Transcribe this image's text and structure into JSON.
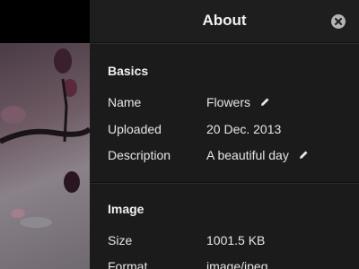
{
  "about_panel": {
    "title": "About",
    "close_icon": "close-circle-icon",
    "basics": {
      "heading": "Basics",
      "rows": [
        {
          "label": "Name",
          "value": "Flowers",
          "editable": true
        },
        {
          "label": "Uploaded",
          "value": "20 Dec. 2013",
          "editable": false
        },
        {
          "label": "Description",
          "value": "A beautiful day",
          "editable": true
        }
      ]
    },
    "image": {
      "heading": "Image",
      "rows": [
        {
          "label": "Size",
          "value": "1001.5 KB"
        },
        {
          "label": "Format",
          "value": "image/jpeg"
        }
      ]
    }
  },
  "colors": {
    "panel_background": "#1b1b1b",
    "text": "#e6e6e6",
    "close_button": "#b3b3b3"
  }
}
